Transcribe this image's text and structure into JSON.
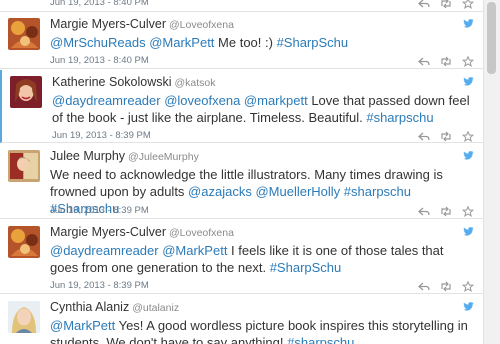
{
  "colors": {
    "link": "#2b7bb9",
    "twitter_blue": "#55acee",
    "selected_border": "#5aa9dd"
  },
  "tweets": [
    {
      "name": "",
      "handle": "",
      "segments": [],
      "timestamp": "Jun 19, 2013 - 8:40 PM",
      "icons": [
        "reply-icon",
        "retweet-icon",
        "favorite-icon"
      ]
    },
    {
      "name": "Margie Myers-Culver",
      "handle": "@Loveofxena",
      "segments": [
        {
          "t": "@MrSchuReads",
          "k": "mention"
        },
        {
          "t": " ",
          "k": "plain"
        },
        {
          "t": "@MarkPett",
          "k": "mention"
        },
        {
          "t": " Me too! :) ",
          "k": "plain"
        },
        {
          "t": "#SharpSchu",
          "k": "tag"
        }
      ],
      "timestamp": "Jun 19, 2013 - 8:40 PM",
      "icons": [
        "twitter-bird-icon",
        "reply-icon",
        "retweet-icon",
        "favorite-icon"
      ]
    },
    {
      "name": "Katherine Sokolowski",
      "handle": "@katsok",
      "segments": [
        {
          "t": "@daydreamreader",
          "k": "mention"
        },
        {
          "t": " ",
          "k": "plain"
        },
        {
          "t": "@loveofxena",
          "k": "mention"
        },
        {
          "t": " ",
          "k": "plain"
        },
        {
          "t": "@markpett",
          "k": "mention"
        },
        {
          "t": " Love that passed down feel of the book - just like the airplane. Timeless. Beautiful. ",
          "k": "plain"
        },
        {
          "t": "#sharpschu",
          "k": "tag"
        }
      ],
      "timestamp": "Jun 19, 2013 - 8:39 PM",
      "icons": [
        "twitter-bird-icon",
        "reply-icon",
        "retweet-icon",
        "favorite-icon"
      ]
    },
    {
      "name": "Julee Murphy",
      "handle": "@JuleeMurphy",
      "segments": [
        {
          "t": "We need to acknowledge the little illustrators. Many times drawing is frowned upon by adults ",
          "k": "plain"
        },
        {
          "t": "@azajacks",
          "k": "mention"
        },
        {
          "t": " ",
          "k": "plain"
        },
        {
          "t": "@MuellerHolly",
          "k": "mention"
        },
        {
          "t": " ",
          "k": "plain"
        },
        {
          "t": "#sharpschu",
          "k": "tag"
        },
        {
          "t": " ",
          "k": "plain"
        },
        {
          "t": "#Sharpschu",
          "k": "tag"
        }
      ],
      "timestamp": "Jun 19, 2013 - 8:39 PM",
      "icons": [
        "twitter-bird-icon",
        "reply-icon",
        "retweet-icon",
        "favorite-icon"
      ]
    },
    {
      "name": "Margie Myers-Culver",
      "handle": "@Loveofxena",
      "segments": [
        {
          "t": "@daydreamreader",
          "k": "mention"
        },
        {
          "t": " ",
          "k": "plain"
        },
        {
          "t": "@MarkPett",
          "k": "mention"
        },
        {
          "t": " I feels like it is one of those tales that goes from one generation to the next. ",
          "k": "plain"
        },
        {
          "t": "#SharpSchu",
          "k": "tag"
        }
      ],
      "timestamp": "Jun 19, 2013 - 8:39 PM",
      "icons": [
        "twitter-bird-icon",
        "reply-icon",
        "retweet-icon",
        "favorite-icon"
      ]
    },
    {
      "name": "Cynthia Alaniz",
      "handle": "@utalaniz",
      "segments": [
        {
          "t": "@MarkPett",
          "k": "mention"
        },
        {
          "t": " Yes! A good wordless picture book inspires this storytelling in students. We don't have to say anything! ",
          "k": "plain"
        },
        {
          "t": "#sharpschu",
          "k": "tag"
        }
      ],
      "timestamp": "",
      "icons": [
        "twitter-bird-icon"
      ]
    }
  ]
}
